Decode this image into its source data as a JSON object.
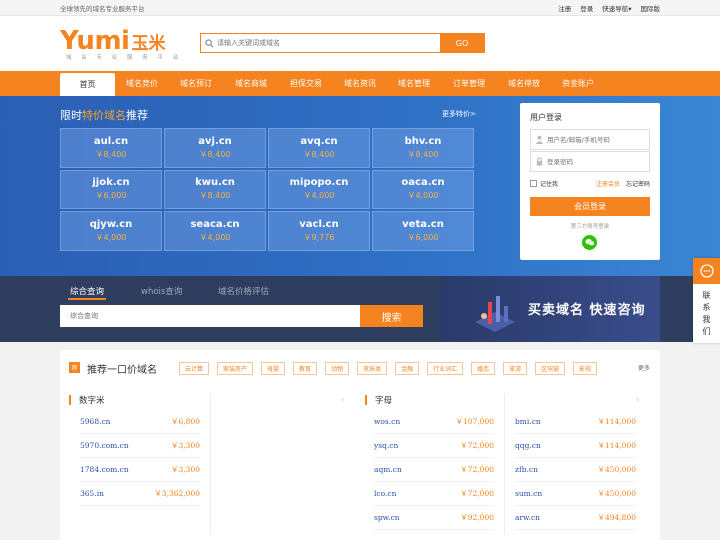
{
  "topbar": {
    "slogan": "全球领先的域名专业服务平台",
    "links": [
      "注册",
      "登录",
      "快速导航▾",
      "国际版"
    ]
  },
  "logo": {
    "latin": "Yumi",
    "cjk": "玉米",
    "sub": "域 名 专 业 服 务 平 台"
  },
  "search": {
    "placeholder": "请输入关键词或域名",
    "go": "GO"
  },
  "nav": [
    "首页",
    "域名竞价",
    "域名预订",
    "域名商城",
    "担保交易",
    "域名资讯",
    "域名管理",
    "订单管理",
    "域名停放",
    "资金账户"
  ],
  "hero": {
    "title_pre": "限时",
    "title_hl": "特价域名",
    "title_post": "推荐",
    "more": "更多特价>",
    "domains": [
      {
        "name": "aul.cn",
        "price": "￥8,400"
      },
      {
        "name": "avj.cn",
        "price": "￥8,400"
      },
      {
        "name": "avq.cn",
        "price": "￥8,400"
      },
      {
        "name": "bhv.cn",
        "price": "￥8,400"
      },
      {
        "name": "jjok.cn",
        "price": "￥6,000"
      },
      {
        "name": "kwu.cn",
        "price": "￥8,400"
      },
      {
        "name": "mipopo.cn",
        "price": "￥4,000"
      },
      {
        "name": "oaca.cn",
        "price": "￥4,000"
      },
      {
        "name": "qjyw.cn",
        "price": "￥4,000"
      },
      {
        "name": "seaca.cn",
        "price": "￥4,000"
      },
      {
        "name": "vacl.cn",
        "price": "￥9,776"
      },
      {
        "name": "veta.cn",
        "price": "￥6,000"
      }
    ]
  },
  "login": {
    "title": "用户登录",
    "user_ph": "用户名/邮箱/手机号码",
    "pass_ph": "登录密码",
    "remember": "记住我",
    "register": "注册会员",
    "forget": "忘记密码",
    "button": "会员登录",
    "third": "第三方账号登录"
  },
  "query": {
    "tabs": [
      "综合查询",
      "whois查询",
      "域名价格评估"
    ],
    "placeholder": "综合查询",
    "button": "搜索",
    "banner": "买卖域名  快速咨询"
  },
  "side": {
    "text": "联系我们"
  },
  "rec": {
    "badge": "荐",
    "title": "推荐一口价域名",
    "tags": [
      "云计算",
      "家装房产",
      "母婴",
      "教育",
      "动物",
      "竞技类",
      "金融",
      "行业词汇",
      "婚恋",
      "旅游",
      "区块链",
      "影视"
    ],
    "more": "更多",
    "left": {
      "title": "数字米",
      "rows": [
        {
          "d": "5968.cn",
          "p": "￥6,800"
        },
        {
          "d": "5970.com.cn",
          "p": "￥3,300"
        },
        {
          "d": "1784.com.cn",
          "p": "￥3,300"
        },
        {
          "d": "365.in",
          "p": "￥3,362,000"
        }
      ]
    },
    "right": {
      "title": "字母",
      "col1": [
        {
          "d": "wos.cn",
          "p": "￥107,000"
        },
        {
          "d": "ysq.cn",
          "p": "￥72,000"
        },
        {
          "d": "aqm.cn",
          "p": "￥72,000"
        },
        {
          "d": "lco.cn",
          "p": "￥72,000"
        },
        {
          "d": "spw.cn",
          "p": "￥92,000"
        }
      ],
      "col2": [
        {
          "d": "bmi.cn",
          "p": "￥114,000"
        },
        {
          "d": "qqg.cn",
          "p": "￥114,000"
        },
        {
          "d": "zfb.cn",
          "p": "￥450,000"
        },
        {
          "d": "sum.cn",
          "p": "￥450,000"
        },
        {
          "d": "arw.cn",
          "p": "￥494,800"
        }
      ]
    }
  },
  "colors": {
    "brand": "#f5831f",
    "link": "#2b4fa8"
  }
}
